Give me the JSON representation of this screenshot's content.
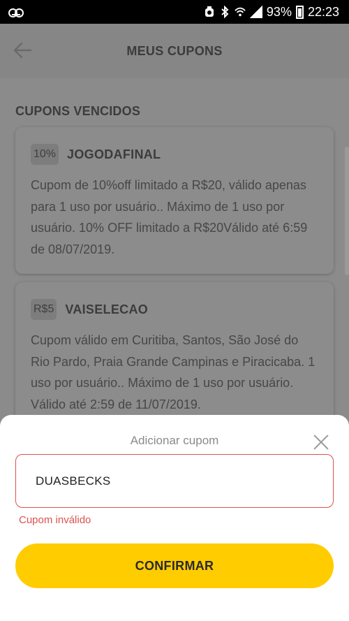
{
  "status_bar": {
    "battery": "93%",
    "time": "22:23",
    "icons": [
      "voicemail-icon",
      "alarm-icon",
      "bluetooth-icon",
      "wifi-icon",
      "signal-icon",
      "battery-icon"
    ]
  },
  "header": {
    "title": "MEUS CUPONS",
    "back_icon": "arrow-left-icon"
  },
  "section": {
    "title": "CUPONS VENCIDOS"
  },
  "coupons": [
    {
      "badge": "10%",
      "code": "JOGODAFINAL",
      "description": "Cupom de 10%off limitado a R$20, válido apenas para 1 uso por usuário.. Máximo de 1 uso por usuário. 10% OFF limitado a R$20Válido até 6:59 de 08/07/2019."
    },
    {
      "badge": "R$5",
      "code": "VAISELECAO",
      "description": "Cupom válido em Curitiba, Santos, São José do Rio Pardo, Praia Grande Campinas e Piracicaba. 1 uso por usuário.. Máximo de 1 uso por usuário. Válido até 2:59 de 11/07/2019."
    }
  ],
  "sheet": {
    "title": "Adicionar cupom",
    "input_value": "DUASBECKS",
    "error": "Cupom inválido",
    "confirm_label": "CONFIRMAR"
  },
  "colors": {
    "accent": "#ffcc00",
    "error": "#d9534f",
    "status_bar": "#000000",
    "overlay": "#8b8b8b"
  }
}
